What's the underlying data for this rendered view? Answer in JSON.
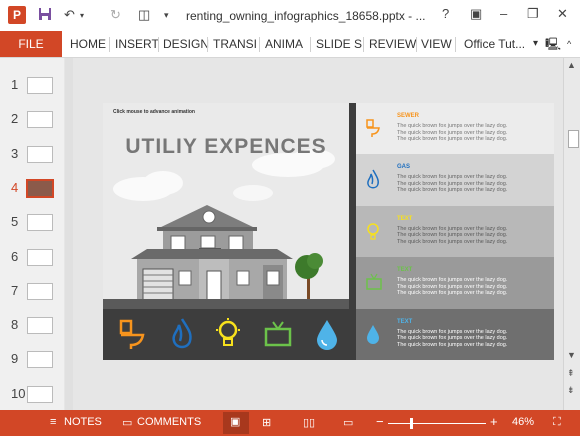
{
  "window": {
    "title": "renting_owning_infographics_18658.pptx - ...",
    "help": "?",
    "minimize": "–",
    "restore": "❐",
    "close": "✕"
  },
  "ribbon": {
    "file": "FILE",
    "tabs": [
      "HOME",
      "INSERT",
      "DESIGN",
      "TRANSI",
      "ANIMA",
      "SLIDE S",
      "REVIEW",
      "VIEW"
    ],
    "account": "Office Tut..."
  },
  "thumbnails": {
    "numbers": [
      "1",
      "2",
      "3",
      "4",
      "5",
      "6",
      "7",
      "8",
      "9",
      "10"
    ],
    "active_index": 4
  },
  "slide": {
    "instruction": "Click mouse to advance animation",
    "title": "UTILIY EXPENCES",
    "rows": [
      {
        "title": "SEWER",
        "title_color": "#f7941d",
        "text": [
          "The quick brown fox jumps over the lazy dog.",
          "The quick brown fox jumps over the lazy dog.",
          "The quick brown fox jumps over the lazy dog."
        ],
        "bg": "#ececec",
        "text_color": "#777777",
        "icon": "toilet-icon"
      },
      {
        "title": "GAS",
        "title_color": "#1f6fbf",
        "text": [
          "The quick brown fox jumps over the lazy dog.",
          "The quick brown fox jumps over the lazy dog.",
          "The quick brown fox jumps over the lazy dog."
        ],
        "bg": "#d3d3d3",
        "text_color": "#666666",
        "icon": "gas-flame-icon"
      },
      {
        "title": "TEXT",
        "title_color": "#f7e11d",
        "text": [
          "The quick brown fox jumps over the lazy dog.",
          "The quick brown fox jumps over the lazy dog.",
          "The quick brown fox jumps over the lazy dog."
        ],
        "bg": "#b8b8b8",
        "text_color": "#5a5a5a",
        "icon": "light-bulb-icon"
      },
      {
        "title": "TEXT",
        "title_color": "#6cc24a",
        "text": [
          "The quick brown fox jumps over the lazy dog.",
          "The quick brown fox jumps over the lazy dog.",
          "The quick brown fox jumps over the lazy dog."
        ],
        "bg": "#9a9a9a",
        "text_color": "#ffffff",
        "icon": "tv-icon"
      },
      {
        "title": "TEXT",
        "title_color": "#4fb3e8",
        "text": [
          "The quick brown fox jumps over the lazy dog.",
          "The quick brown fox jumps over the lazy dog.",
          "The quick brown fox jumps over the lazy dog."
        ],
        "bg": "#6f6f6f",
        "text_color": "#ffffff",
        "icon": "water-drop-icon"
      }
    ]
  },
  "status": {
    "notes": "NOTES",
    "comments": "COMMENTS",
    "zoom": "46%",
    "zoom_fraction": 0.46
  },
  "colors": {
    "accent": "#d24726"
  }
}
